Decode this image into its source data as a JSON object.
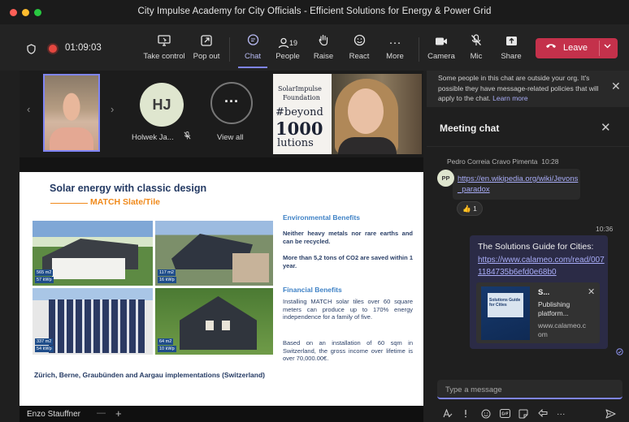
{
  "window": {
    "title": "City Impulse Academy for City Officials - Efficient Solutions for Energy & Power Grid",
    "traffic_colors": [
      "#ff5f57",
      "#febc2e",
      "#28c840"
    ]
  },
  "toolbar": {
    "timer": "01:09:03",
    "buttons": {
      "take_control": "Take control",
      "pop_out": "Pop out",
      "chat": "Chat",
      "people": "People",
      "people_count": "19",
      "raise": "Raise",
      "react": "React",
      "more": "More",
      "camera": "Camera",
      "mic": "Mic",
      "share": "Share"
    },
    "leave_label": "Leave",
    "accent": "#7f85f5",
    "leave_color": "#c4314b"
  },
  "participants": {
    "hj_initials": "HJ",
    "hj_name": "Holwek Ja...",
    "view_all_label": "View all",
    "view_all_glyph": "···",
    "poster_lines": [
      "SolarImpulse",
      "Foundation",
      "#beyond",
      "1000",
      "lutions"
    ]
  },
  "slide": {
    "title": "Solar energy with classic design",
    "subtitle": "MATCH Slate/Tile",
    "photo_tags": [
      [
        "565 m2",
        "57 kWp"
      ],
      [
        "117 m2",
        "16 kWp"
      ],
      [
        "337 m2",
        "54 kWp"
      ],
      [
        "64 m2",
        "10 kWp"
      ]
    ],
    "caption": "Zürich, Berne, Graubünden and Aargau implementations (Switzerland)",
    "env_heading": "Environmental Benefits",
    "env_p1": "Neither heavy metals nor rare earths and can be recycled.",
    "env_p2": "More than 5,2 tons of CO2 are saved within 1 year.",
    "fin_heading": "Financial Benefits",
    "fin_p1": "Installing MATCH solar tiles over 60 square meters can produce up to 170% energy independence for a family of five.",
    "fin_p2": "Based on an installation of 60 sqm in Switzerland, the gross income over lifetime is over 70,000.00€."
  },
  "presenter": {
    "name": "Enzo Stauffner"
  },
  "chat": {
    "notice_text": "Some people in this chat are outside your org. It's possible they have message-related policies that will apply to the chat.",
    "notice_link": "Learn more",
    "title": "Meeting chat",
    "msg1": {
      "sender": "Pedro Correia Cravo Pimenta",
      "time": "10:28",
      "initials": "PP",
      "link": "https://en.wikipedia.org/wiki/Jevons_paradox",
      "reaction_emoji": "👍",
      "reaction_count": "1"
    },
    "msg2": {
      "time": "10:36",
      "text": "The Solutions Guide for Cities:",
      "link": "https://www.calameo.com/read/0071184735b6efd0e68b0",
      "preview_title": "S...",
      "preview_desc": "Publishing platform...",
      "preview_domain": "www.calameo.com",
      "book_title": "Solutions Guide for Cities"
    },
    "compose_placeholder": "Type a message"
  }
}
